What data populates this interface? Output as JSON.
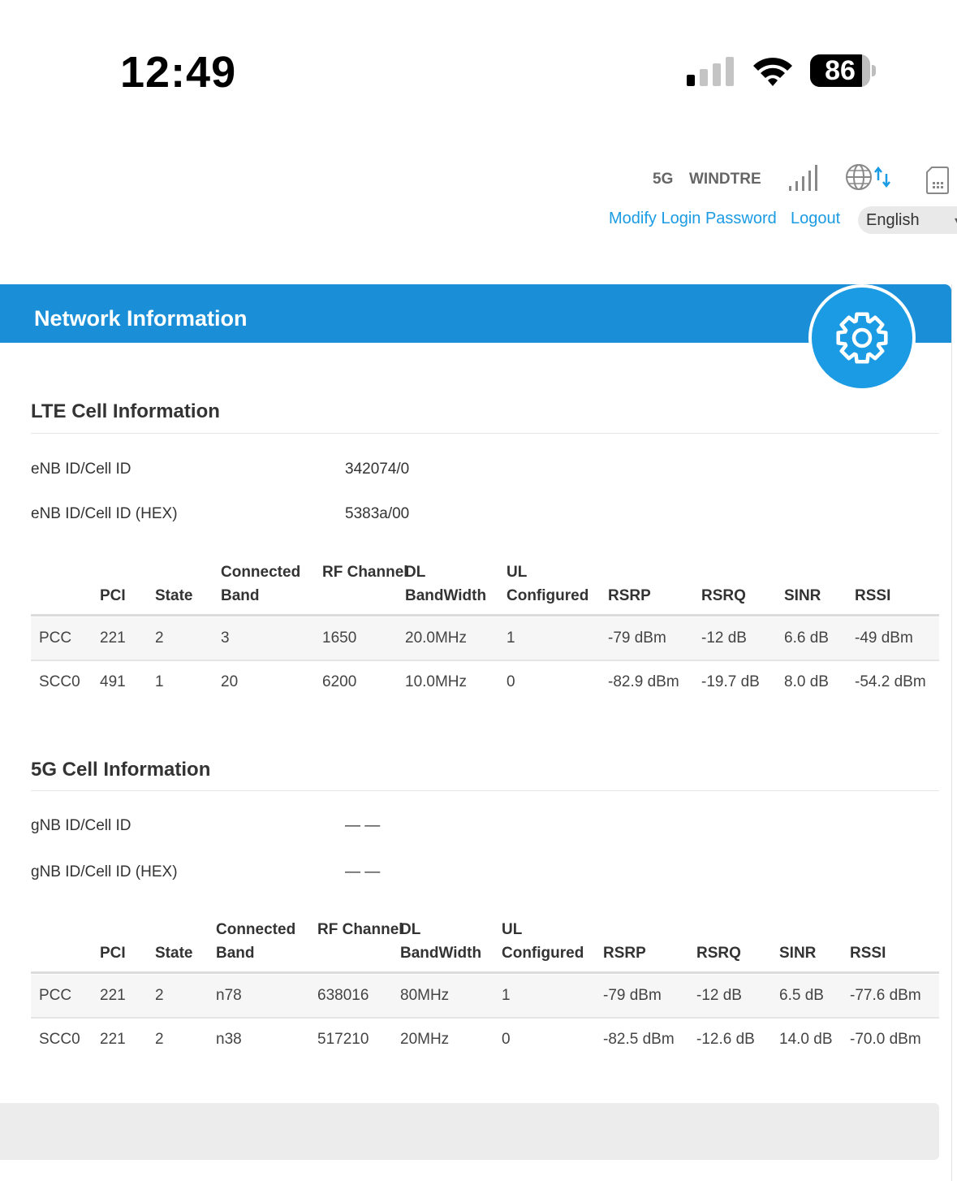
{
  "status_bar": {
    "time": "12:49",
    "battery": "86",
    "battery_level_pct": 86
  },
  "header": {
    "network_type": "5G",
    "operator": "WINDTRE",
    "modify_password_link": "Modify Login Password",
    "logout_link": "Logout",
    "language": "English"
  },
  "card": {
    "title": "Network Information"
  },
  "lte": {
    "title": "LTE Cell Information",
    "fields": [
      {
        "label": "eNB ID/Cell ID",
        "value": "342074/0"
      },
      {
        "label": "eNB ID/Cell ID (HEX)",
        "value": "5383a/00"
      }
    ],
    "columns": [
      "",
      "PCI",
      "State",
      "Connected Band",
      "RF Channel",
      "DL BandWidth",
      "UL Configured",
      "RSRP",
      "RSRQ",
      "SINR",
      "RSSI"
    ],
    "rows": [
      [
        "PCC",
        "221",
        "2",
        "3",
        "1650",
        "20.0MHz",
        "1",
        "-79 dBm",
        "-12 dB",
        "6.6 dB",
        "-49 dBm"
      ],
      [
        "SCC0",
        "491",
        "1",
        "20",
        "6200",
        "10.0MHz",
        "0",
        "-82.9 dBm",
        "-19.7 dB",
        "8.0 dB",
        "-54.2 dBm"
      ]
    ]
  },
  "nr": {
    "title": "5G Cell Information",
    "fields": [
      {
        "label": "gNB ID/Cell ID",
        "value": "— —"
      },
      {
        "label": "gNB ID/Cell ID (HEX)",
        "value": "— —"
      }
    ],
    "columns": [
      "",
      "PCI",
      "State",
      "Connected Band",
      "RF Channel",
      "DL BandWidth",
      "UL Configured",
      "RSRP",
      "RSRQ",
      "SINR",
      "RSSI"
    ],
    "rows": [
      [
        "PCC",
        "221",
        "2",
        "n78",
        "638016",
        "80MHz",
        "1",
        "-79 dBm",
        "-12 dB",
        "6.5 dB",
        "-77.6 dBm"
      ],
      [
        "SCC0",
        "221",
        "2",
        "n38",
        "517210",
        "20MHz",
        "0",
        "-82.5 dBm",
        "-12.6 dB",
        "14.0 dB",
        "-70.0 dBm"
      ]
    ]
  },
  "colors": {
    "accent": "#1a8fd8",
    "link": "#1a9be3"
  }
}
